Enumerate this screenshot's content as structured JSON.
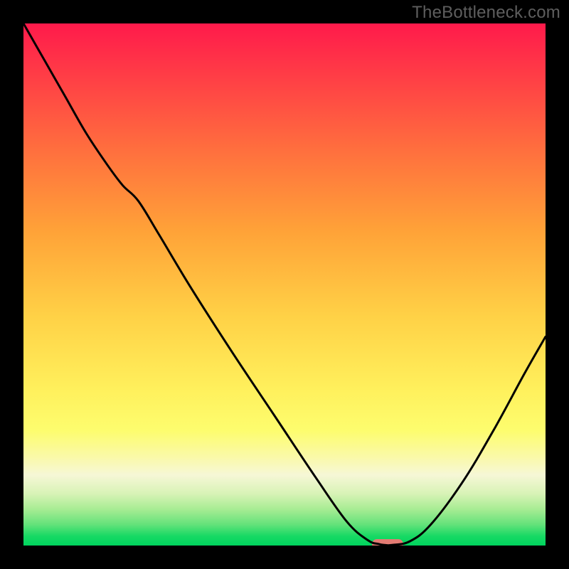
{
  "watermark": "TheBottleneck.com",
  "chart_data": {
    "type": "line",
    "title": "",
    "xlabel": "",
    "ylabel": "",
    "xlim": [
      0,
      100
    ],
    "ylim": [
      0,
      100
    ],
    "grid": false,
    "legend": false,
    "background_gradient": {
      "direction": "vertical",
      "stops": [
        {
          "pos": 0.0,
          "color": "#ff1a4b"
        },
        {
          "pos": 0.24,
          "color": "#ff6e3e"
        },
        {
          "pos": 0.56,
          "color": "#ffd146"
        },
        {
          "pos": 0.78,
          "color": "#fdfd6e"
        },
        {
          "pos": 0.865,
          "color": "#f6f7d6"
        },
        {
          "pos": 0.96,
          "color": "#63e27a"
        },
        {
          "pos": 1.0,
          "color": "#00d45e"
        }
      ]
    },
    "series": [
      {
        "name": "bottleneck-curve",
        "color": "#000000",
        "x": [
          0.0,
          4.0,
          8.0,
          12.0,
          16.0,
          19.0,
          22.0,
          26.0,
          32.0,
          40.0,
          48.0,
          56.0,
          62.0,
          66.0,
          68.0,
          69.2,
          70.6,
          74.0,
          78.0,
          84.0,
          90.0,
          96.0,
          100.0
        ],
        "y": [
          100.0,
          93.0,
          86.0,
          79.0,
          73.0,
          69.0,
          66.0,
          59.5,
          49.5,
          37.0,
          25.0,
          13.0,
          4.5,
          1.0,
          0.3,
          0.1,
          0.1,
          0.8,
          4.0,
          12.0,
          22.0,
          33.0,
          40.0
        ]
      }
    ],
    "marker": {
      "name": "optimal-zone",
      "color": "#e37b73",
      "shape": "pill",
      "x_center": 69.8,
      "y_center": 0.3,
      "x_width": 6.0
    }
  }
}
